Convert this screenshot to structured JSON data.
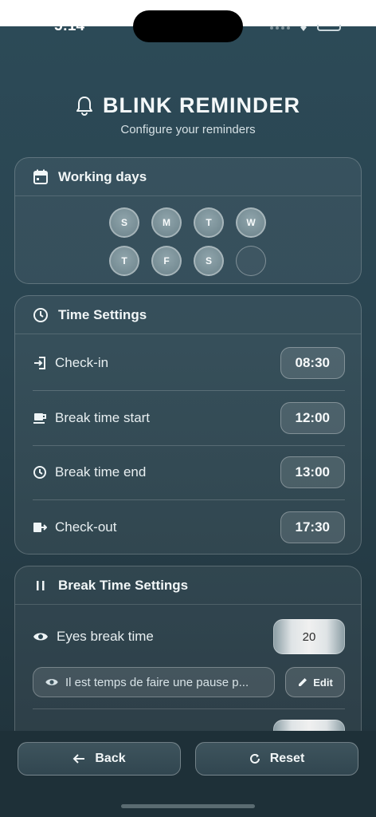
{
  "status_bar": {
    "time": "5:14"
  },
  "header": {
    "title": "BLINK REMINDER",
    "subtitle": "Configure your reminders"
  },
  "working_days": {
    "title": "Working days",
    "days": [
      "S",
      "M",
      "T",
      "W",
      "T",
      "F",
      "S",
      ""
    ]
  },
  "time_settings": {
    "title": "Time Settings",
    "rows": [
      {
        "label": "Check-in",
        "value": "08:30",
        "icon": "login-icon"
      },
      {
        "label": "Break time start",
        "value": "12:00",
        "icon": "coffee-icon"
      },
      {
        "label": "Break time end",
        "value": "13:00",
        "icon": "clock-icon"
      },
      {
        "label": "Check-out",
        "value": "17:30",
        "icon": "logout-icon"
      }
    ]
  },
  "break_settings": {
    "title": "Break Time Settings",
    "eyes_break_label": "Eyes break time",
    "eyes_break_value": "20",
    "message_value": "Il est temps de faire une pause p...",
    "edit_label": "Edit"
  },
  "footer": {
    "back_label": "Back",
    "reset_label": "Reset"
  },
  "colors": {
    "background": "#2a4450",
    "card_border": "#5f7680",
    "accent_text": "#eef4f6"
  }
}
